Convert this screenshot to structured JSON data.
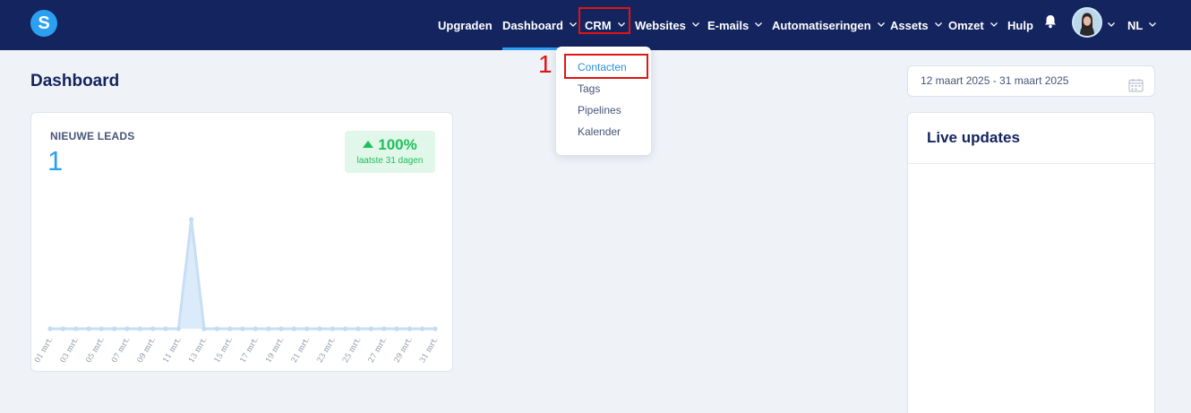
{
  "logo": {
    "letter": "S"
  },
  "nav": {
    "upgrade": "Upgraden",
    "dashboard": "Dashboard",
    "crm": "CRM",
    "websites": "Websites",
    "emails": "E-mails",
    "automations": "Automatiseringen",
    "assets": "Assets",
    "revenue": "Omzet",
    "help": "Hulp",
    "language": "NL"
  },
  "crm_menu": {
    "items": [
      "Contacten",
      "Tags",
      "Pipelines",
      "Kalender"
    ],
    "active": "Contacten"
  },
  "annotation": {
    "step": "1"
  },
  "page_title": "Dashboard",
  "date_range": "12 maart 2025 - 31 maart 2025",
  "leads_card": {
    "label": "NIEUWE LEADS",
    "value": "1",
    "change": "100%",
    "change_period": "laatste 31 dagen"
  },
  "live_updates": {
    "title": "Live updates"
  },
  "colors": {
    "nav_bg": "#13245f",
    "accent": "#2b9ff2",
    "positive": "#1fbf5b",
    "highlight": "#e11414"
  },
  "chart_data": {
    "type": "area",
    "x": [
      "01 mrt.",
      "02 mrt.",
      "03 mrt.",
      "04 mrt.",
      "05 mrt.",
      "06 mrt.",
      "07 mrt.",
      "08 mrt.",
      "09 mrt.",
      "10 mrt.",
      "11 mrt.",
      "12 mrt.",
      "13 mrt.",
      "14 mrt.",
      "15 mrt.",
      "16 mrt.",
      "17 mrt.",
      "18 mrt.",
      "19 mrt.",
      "20 mrt.",
      "21 mrt.",
      "22 mrt.",
      "23 mrt.",
      "24 mrt.",
      "25 mrt.",
      "26 mrt.",
      "27 mrt.",
      "28 mrt.",
      "29 mrt.",
      "30 mrt.",
      "31 mrt."
    ],
    "tick_labels": [
      "01 mrt.",
      "03 mrt.",
      "05 mrt.",
      "07 mrt.",
      "09 mrt.",
      "11 mrt.",
      "13 mrt.",
      "15 mrt.",
      "17 mrt.",
      "19 mrt.",
      "21 mrt.",
      "23 mrt.",
      "25 mrt.",
      "27 mrt.",
      "29 mrt.",
      "31 mrt."
    ],
    "series": [
      {
        "values": [
          0,
          0,
          0,
          0,
          0,
          0,
          0,
          0,
          0,
          0,
          0,
          1,
          0,
          0,
          0,
          0,
          0,
          0,
          0,
          0,
          0,
          0,
          0,
          0,
          0,
          0,
          0,
          0,
          0,
          0,
          0
        ]
      }
    ],
    "ylim": [
      0,
      1
    ],
    "grid": false,
    "color": "#2b9ff2"
  }
}
